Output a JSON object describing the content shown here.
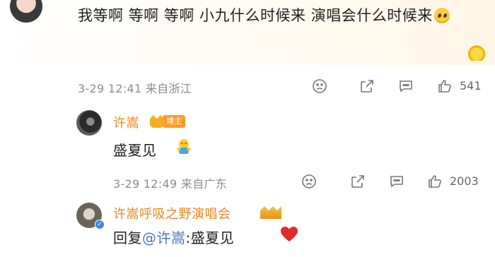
{
  "post": {
    "text": "我等啊 等啊 等啊 小九什么时候来 演唱会什么时候来",
    "emoji": "pleading-face",
    "time": "3-29 12:41",
    "location": "来自浙江",
    "like_count": "541"
  },
  "reply1": {
    "username": "许嵩",
    "badge": "博主",
    "text": "盛夏见",
    "emoji": "holding-emoji",
    "time": "3-29 12:49",
    "location": "来自广东",
    "like_count": "2003"
  },
  "reply2": {
    "username": "许嵩呼吸之野演唱会",
    "prefix": "回复",
    "mention": "@许嵩",
    "text": ":盛夏见",
    "emoji": "red-heart"
  },
  "colors": {
    "username": "#e8871e",
    "mention": "#4a78b8",
    "meta": "#8c8c8c"
  }
}
